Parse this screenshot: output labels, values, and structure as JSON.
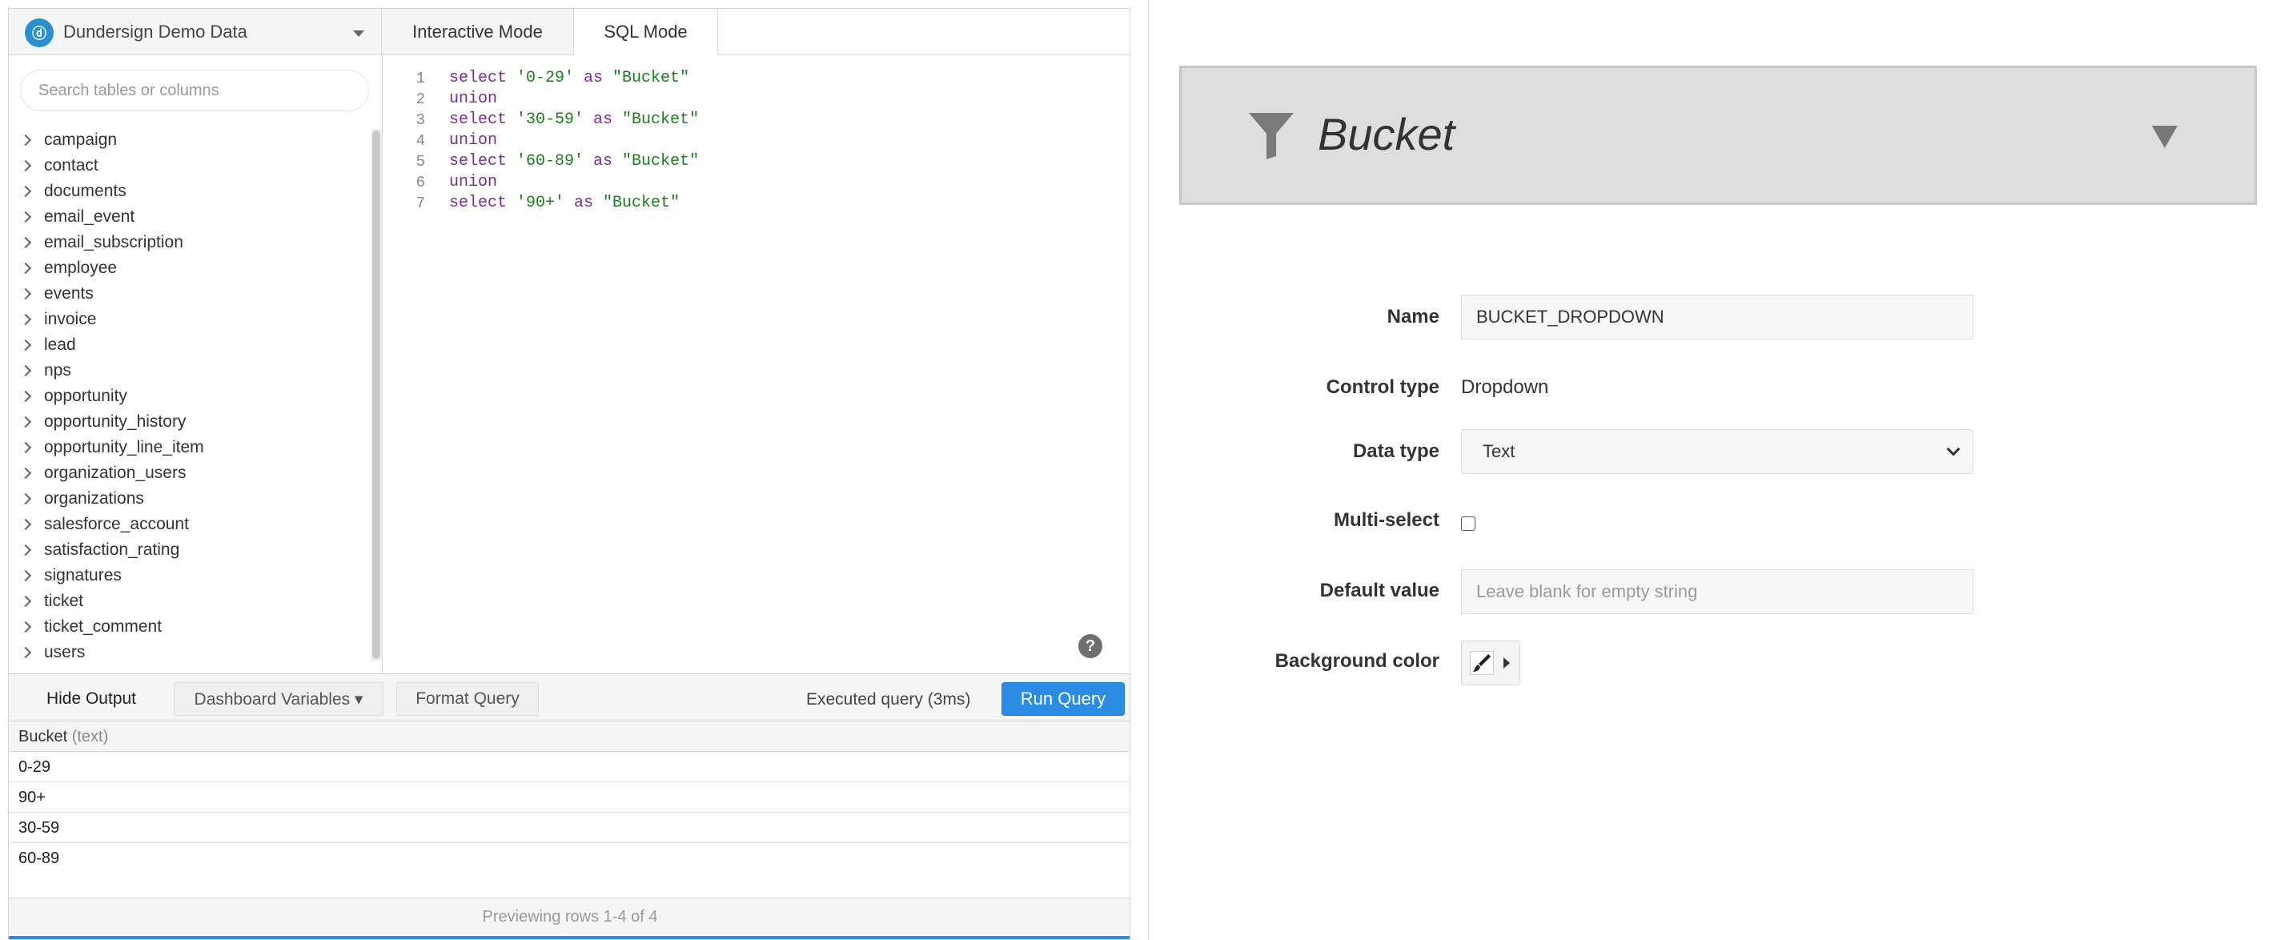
{
  "database": {
    "name": "Dundersign Demo Data"
  },
  "tabs": [
    {
      "label": "Interactive Mode",
      "active": false
    },
    {
      "label": "SQL Mode",
      "active": true
    }
  ],
  "search": {
    "placeholder": "Search tables or columns"
  },
  "tables": [
    "campaign",
    "contact",
    "documents",
    "email_event",
    "email_subscription",
    "employee",
    "events",
    "invoice",
    "lead",
    "nps",
    "opportunity",
    "opportunity_history",
    "opportunity_line_item",
    "organization_users",
    "organizations",
    "salesforce_account",
    "satisfaction_rating",
    "signatures",
    "ticket",
    "ticket_comment",
    "users"
  ],
  "code": {
    "line_numbers": [
      "1",
      "2",
      "3",
      "4",
      "5",
      "6",
      "7"
    ],
    "lines": [
      {
        "kw1": "select",
        "s1": " '0-29'",
        "kw2": " as",
        "s2": " \"Bucket\""
      },
      {
        "kw1": "union",
        "s1": "",
        "kw2": "",
        "s2": ""
      },
      {
        "kw1": "select",
        "s1": " '30-59'",
        "kw2": " as",
        "s2": " \"Bucket\""
      },
      {
        "kw1": "union",
        "s1": "",
        "kw2": "",
        "s2": ""
      },
      {
        "kw1": "select",
        "s1": " '60-89'",
        "kw2": " as",
        "s2": " \"Bucket\""
      },
      {
        "kw1": "union",
        "s1": "",
        "kw2": "",
        "s2": ""
      },
      {
        "kw1": "select",
        "s1": " '90+'",
        "kw2": " as",
        "s2": " \"Bucket\""
      }
    ]
  },
  "help": {
    "glyph": "?"
  },
  "toolbar": {
    "hide_output": "Hide Output",
    "dashboard_variables": "Dashboard Variables ▾",
    "format_query": "Format Query",
    "status": "Executed query (3ms)",
    "run_query": "Run Query"
  },
  "results": {
    "column": "Bucket",
    "column_type": "(text)",
    "rows": [
      "0-29",
      "90+",
      "30-59",
      "60-89"
    ],
    "preview": "Previewing rows 1-4 of 4"
  },
  "control": {
    "title": "Bucket",
    "fields": {
      "name_label": "Name",
      "name_value": "BUCKET_DROPDOWN",
      "control_type_label": "Control type",
      "control_type_value": "Dropdown",
      "data_type_label": "Data type",
      "data_type_value": "Text",
      "multi_select_label": "Multi-select",
      "multi_select_checked": false,
      "default_value_label": "Default value",
      "default_value_placeholder": "Leave blank for empty string",
      "background_color_label": "Background color"
    }
  },
  "colors": {
    "accent": "#2a8ce2",
    "keyword": "#7a2a9a",
    "string": "#1a7f1a"
  }
}
